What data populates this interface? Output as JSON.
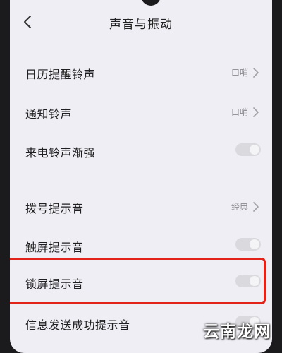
{
  "header": {
    "title": "声音与振动",
    "back_icon": "chevron-left-icon"
  },
  "settings": [
    {
      "label": "日历提醒铃声",
      "value": "口哨",
      "control": "chevron"
    },
    {
      "label": "通知铃声",
      "value": "口哨",
      "control": "chevron"
    },
    {
      "label": "来电铃声渐强",
      "control": "toggle",
      "enabled": false
    },
    {
      "label": "拨号提示音",
      "value": "经典",
      "control": "chevron"
    },
    {
      "label": "触屏提示音",
      "control": "toggle",
      "enabled": false
    },
    {
      "label": "锁屏提示音",
      "control": "toggle",
      "enabled": false,
      "highlighted": true
    },
    {
      "label": "信息发送成功提示音",
      "control": "toggle",
      "enabled": false
    }
  ],
  "highlight_color": "#e2231a",
  "watermark": {
    "text": "云南龙网"
  }
}
